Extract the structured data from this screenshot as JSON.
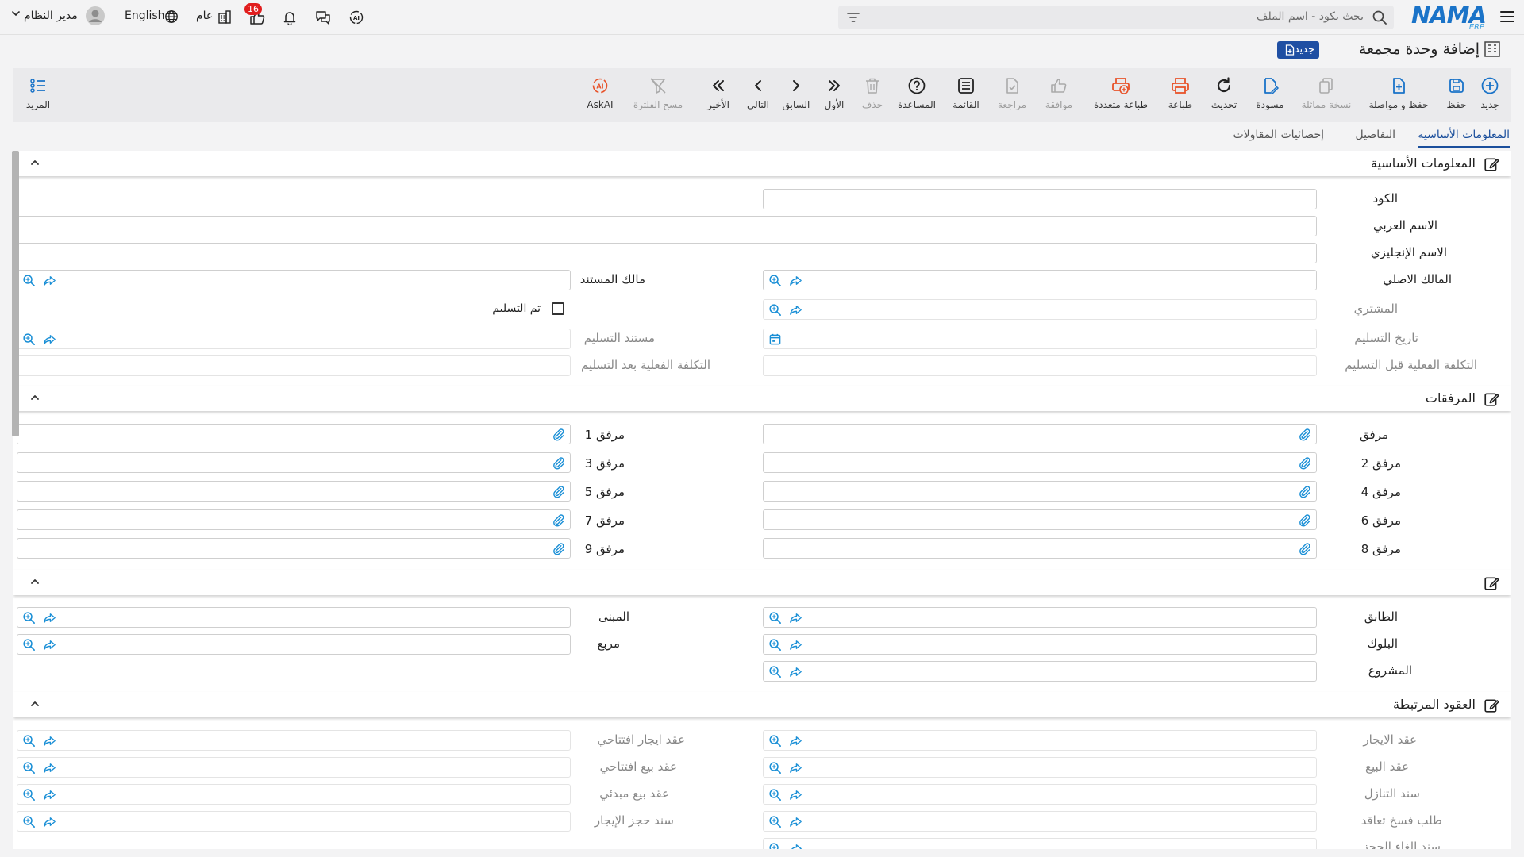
{
  "topbar": {
    "search_placeholder": "بحث بكود - اسم الملف",
    "logo_text": "NAMA",
    "logo_sub": "ERP",
    "user_name": "مدير النظام",
    "language": "English",
    "branch": "عام",
    "notification_count": "16"
  },
  "page": {
    "title": "إضافة وحدة مجمعة",
    "badge": "جديد"
  },
  "toolbar": {
    "new": "جديد",
    "save": "حفظ",
    "save_continue": "حفظ و مواصلة",
    "duplicate": "نسخة مماثلة",
    "draft": "مسودة",
    "refresh": "تحديث",
    "print": "طباعة",
    "multi_print": "طباعة متعددة",
    "approve": "موافقة",
    "review": "مراجعة",
    "list": "القائمة",
    "help": "المساعدة",
    "delete": "حذف",
    "first": "الأول",
    "previous": "السابق",
    "next": "التالي",
    "last": "الأخير",
    "clear_filter": "مسح الفلترة",
    "askai": "AskAI",
    "more": "المزيد"
  },
  "tabs": {
    "basic": "المعلومات الأساسية",
    "details": "التفاصيل",
    "contract_stats": "إحصائيات المقاولات"
  },
  "sections": {
    "basic": {
      "title": "المعلومات الأساسية",
      "code": "الكود",
      "arabic_name": "الاسم العربي",
      "english_name": "الاسم الإنجليزي",
      "original_owner": "المالك الاصلي",
      "document_owner": "مالك المستند",
      "buyer": "المشتري",
      "delivered": "تم التسليم",
      "delivery_date": "تاريخ التسليم",
      "delivery_document": "مستند التسليم",
      "cost_before": "التكلفة الفعلية قبل التسليم",
      "cost_after": "التكلفة الفعلية بعد التسليم"
    },
    "attachments": {
      "title": "المرفقات",
      "a0": "مرفق",
      "a1": "مرفق 1",
      "a2": "مرفق 2",
      "a3": "مرفق 3",
      "a4": "مرفق 4",
      "a5": "مرفق 5",
      "a6": "مرفق 6",
      "a7": "مرفق 7",
      "a8": "مرفق 8",
      "a9": "مرفق 9"
    },
    "location": {
      "title": "",
      "floor": "الطابق",
      "building": "المبنى",
      "block": "البلوك",
      "square": "مربع",
      "project": "المشروع"
    },
    "contracts": {
      "title": "العقود المرتبطة",
      "lease": "عقد الايجار",
      "opening_lease": "عقد ايجار افتتاحي",
      "sale": "عقد البيع",
      "opening_sale": "عقد بيع افتتاحي",
      "waiver": "سند التنازل",
      "preliminary_sale": "عقد بيع مبدئي",
      "termination_request": "طلب فسخ تعاقد",
      "lease_booking": "سند حجز الإيجار",
      "booking_cancel": "سند الغاء الحجز"
    }
  }
}
